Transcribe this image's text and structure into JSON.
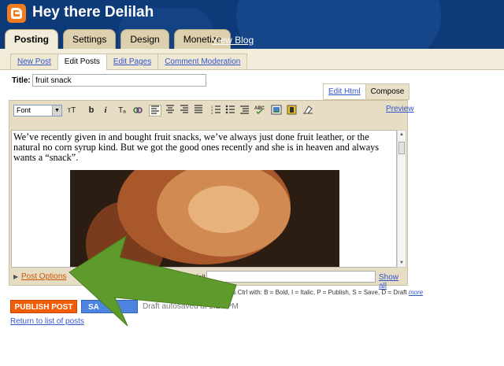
{
  "header": {
    "blog_title": "Hey there Delilah",
    "logo_icon": "blogger-logo-icon",
    "view_blog": "View Blog",
    "colors": {
      "bar": "#0d3a78",
      "logo": "#f47c20"
    }
  },
  "main_tabs": [
    {
      "label": "Posting",
      "active": true
    },
    {
      "label": "Settings",
      "active": false
    },
    {
      "label": "Design",
      "active": false
    },
    {
      "label": "Monetize",
      "active": false
    }
  ],
  "sub_tabs": [
    {
      "label": "New Post",
      "active": false
    },
    {
      "label": "Edit Posts",
      "active": true
    },
    {
      "label": "Edit Pages",
      "active": false
    },
    {
      "label": "Comment Moderation",
      "active": false
    }
  ],
  "title_field": {
    "label": "Title:",
    "value": "fruit snack"
  },
  "mode_tabs": {
    "edit_html": "Edit Html",
    "compose": "Compose"
  },
  "toolbar": {
    "font_select": "Font",
    "font_size_glyph": "ᴛT",
    "bold": "b",
    "italic": "i",
    "text_color_glyph": "Tₐ",
    "preview": "Preview",
    "icons": [
      "font-size-icon",
      "bold-icon",
      "italic-icon",
      "text-color-icon",
      "link-icon",
      "align-left-icon",
      "align-center-icon",
      "align-right-icon",
      "justify-icon",
      "numbered-list-icon",
      "bullet-list-icon",
      "blockquote-icon",
      "spellcheck-icon",
      "insert-image-icon",
      "insert-video-icon",
      "remove-formatting-icon"
    ]
  },
  "body_text": "We’ve recently given in and bought fruit snacks, we’ve always just done fruit leather, or the natural no corn syrup kind. But we got the good ones recently and she is in heaven and always wants a “snack”.",
  "post_options": {
    "label": "Post Options",
    "labels_fragment": "fall",
    "show_all": "Show all"
  },
  "shortcuts": {
    "text": "rtcuts: press Ctrl with: B = Bold, I = Italic, P = Publish, S = Save, D = Draft",
    "more": "more"
  },
  "actions": {
    "publish": "PUBLISH POST",
    "save": "SA",
    "autosave": "Draft autosaved at 2:26 PM",
    "return": "Return to list of posts",
    "colors": {
      "publish": "#f25c05",
      "save": "#4d84e0",
      "annotation_arrow": "#5f9a2c"
    }
  }
}
